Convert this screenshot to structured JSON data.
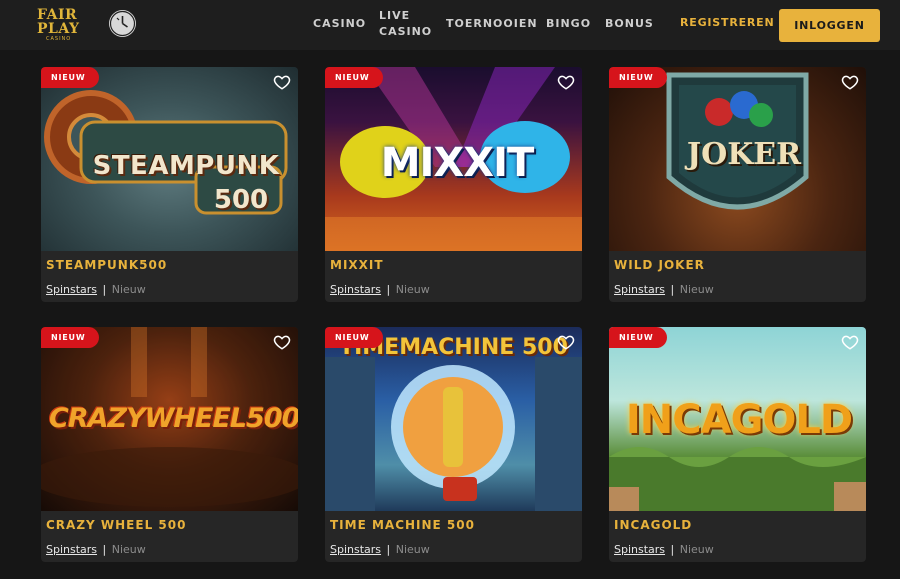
{
  "header": {
    "logo": {
      "line1": "FAIR",
      "line2": "PLAY",
      "line3": "CASINO"
    },
    "nav": [
      {
        "label": "CASINO"
      },
      {
        "label": "LIVE CASINO"
      },
      {
        "label": "TOERNOOIEN"
      },
      {
        "label": "BINGO"
      },
      {
        "label": "BONUS"
      }
    ],
    "register_label": "REGISTREREN",
    "login_label": "INLOGGEN"
  },
  "games": [
    {
      "title": "STEAMPUNK500",
      "badge": "NIEUW",
      "provider": "Spinstars",
      "separator": "|",
      "tag": "Nieuw",
      "art_text": "STEAMPUNK",
      "art_text2": "500"
    },
    {
      "title": "MIXXIT",
      "badge": "NIEUW",
      "provider": "Spinstars",
      "separator": "|",
      "tag": "Nieuw",
      "art_text": "MIXXIT"
    },
    {
      "title": "WILD JOKER",
      "badge": "NIEUW",
      "provider": "Spinstars",
      "separator": "|",
      "tag": "Nieuw",
      "art_text": "JOKER"
    },
    {
      "title": "CRAZY WHEEL 500",
      "badge": "NIEUW",
      "provider": "Spinstars",
      "separator": "|",
      "tag": "Nieuw",
      "art_text": "CRAZYWHEEL500"
    },
    {
      "title": "TIME MACHINE 500",
      "badge": "NIEUW",
      "provider": "Spinstars",
      "separator": "|",
      "tag": "Nieuw",
      "art_text": "TIMEMACHINE 500"
    },
    {
      "title": "INCAGOLD",
      "badge": "NIEUW",
      "provider": "Spinstars",
      "separator": "|",
      "tag": "Nieuw",
      "art_text": "INCAGOLD"
    }
  ],
  "colors": {
    "accent": "#e8b23c",
    "badge": "#d6141b",
    "background": "#161616",
    "card": "#262626"
  },
  "icons": {
    "history": "clock-icon",
    "favorite": "heart-outline-icon"
  }
}
